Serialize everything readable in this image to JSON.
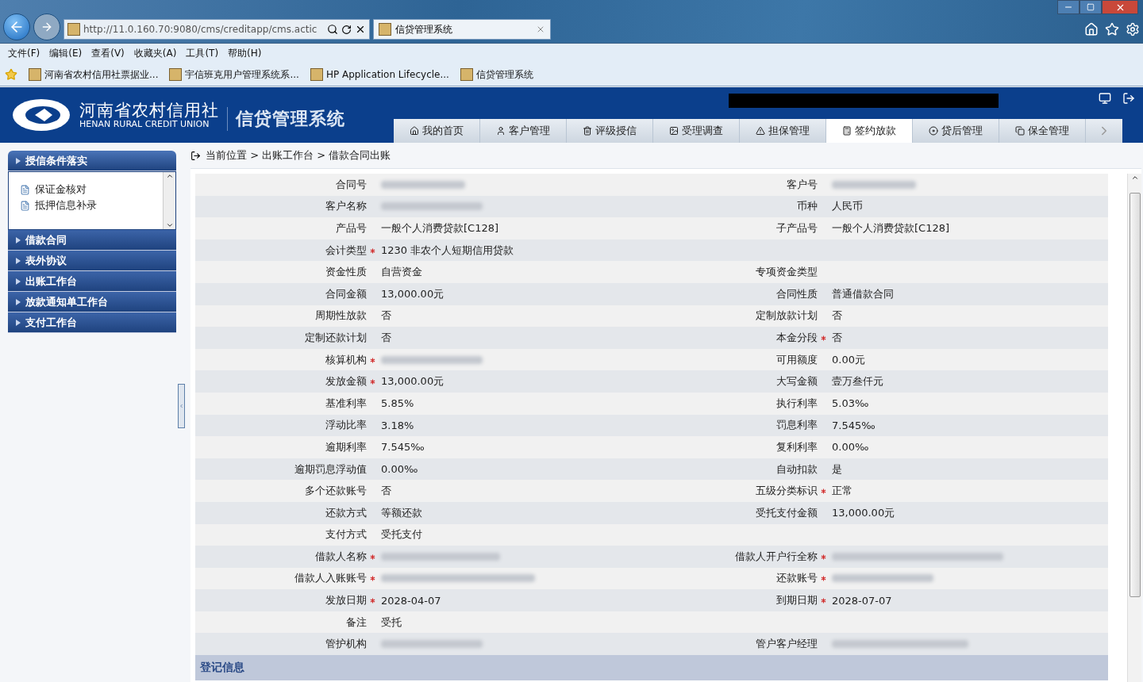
{
  "browser": {
    "address": "http://11.0.160.70:9080/cms/creditapp/cms.actic",
    "tabs": [
      {
        "title": "信贷管理系统",
        "selected": true
      }
    ],
    "menu": [
      "文件(F)",
      "编辑(E)",
      "查看(V)",
      "收藏夹(A)",
      "工具(T)",
      "帮助(H)"
    ],
    "favorites": [
      "河南省农村信用社票据业...",
      "宇信班克用户管理系统系...",
      "HP Application Lifecycle...",
      "信贷管理系统"
    ]
  },
  "header": {
    "org_name": "河南省农村信用社",
    "org_name_en": "HENAN RURAL CREDIT UNION",
    "system_name": "信贷管理系统",
    "redacted": true
  },
  "nav": [
    {
      "label": "我的首页",
      "selected": false
    },
    {
      "label": "客户管理",
      "selected": false
    },
    {
      "label": "评级授信",
      "selected": false
    },
    {
      "label": "受理调查",
      "selected": false
    },
    {
      "label": "担保管理",
      "selected": false
    },
    {
      "label": "签约放款",
      "selected": true
    },
    {
      "label": "贷后管理",
      "selected": false
    },
    {
      "label": "保全管理",
      "selected": false
    }
  ],
  "sidebar": [
    {
      "label": "授信条件落实",
      "expanded": true,
      "children": [
        "保证金核对",
        "抵押信息补录"
      ]
    },
    {
      "label": "借款合同",
      "expanded": false
    },
    {
      "label": "表外协议",
      "expanded": false
    },
    {
      "label": "出账工作台",
      "expanded": false
    },
    {
      "label": "放款通知单工作台",
      "expanded": false
    },
    {
      "label": "支付工作台",
      "expanded": false
    }
  ],
  "breadcrumb": "当前位置 > 出账工作台 > 借款合同出账",
  "form_rows": [
    [
      {
        "label": "合同号",
        "required": false,
        "redacted": true
      },
      {
        "label": "客户号",
        "required": false,
        "redacted": true
      }
    ],
    [
      {
        "label": "客户名称",
        "required": false,
        "redacted": true
      },
      {
        "label": "币种",
        "required": false,
        "value": "人民币"
      }
    ],
    [
      {
        "label": "产品号",
        "required": false,
        "value": "一般个人消费贷款[C128]"
      },
      {
        "label": "子产品号",
        "required": false,
        "value": "一般个人消费贷款[C128]"
      }
    ],
    [
      {
        "label": "会计类型",
        "required": true,
        "value": "1230 非农个人短期信用贷款"
      }
    ],
    [
      {
        "label": "资金性质",
        "required": false,
        "value": "自营资金"
      },
      {
        "label": "专项资金类型",
        "required": false
      }
    ],
    [
      {
        "label": "合同金额",
        "required": false,
        "value": "13,000.00元"
      },
      {
        "label": "合同性质",
        "required": false,
        "value": "普通借款合同"
      }
    ],
    [
      {
        "label": "周期性放款",
        "required": false,
        "value": "否"
      },
      {
        "label": "定制放款计划",
        "required": false,
        "value": "否"
      }
    ],
    [
      {
        "label": "定制还款计划",
        "required": false,
        "value": "否"
      },
      {
        "label": "本金分段",
        "required": true,
        "value": "否"
      }
    ],
    [
      {
        "label": "核算机构",
        "required": true,
        "redacted": true
      },
      {
        "label": "可用额度",
        "required": false,
        "value": "0.00元"
      }
    ],
    [
      {
        "label": "发放金额",
        "required": true,
        "value": "13,000.00元"
      },
      {
        "label": "大写金额",
        "required": false,
        "value": "壹万叁仟元"
      }
    ],
    [
      {
        "label": "基准利率",
        "required": false,
        "value": "5.85%"
      },
      {
        "label": "执行利率",
        "required": false,
        "value": "5.03‰"
      }
    ],
    [
      {
        "label": "浮动比率",
        "required": false,
        "value": "3.18%"
      },
      {
        "label": "罚息利率",
        "required": false,
        "value": "7.545‰"
      }
    ],
    [
      {
        "label": "逾期利率",
        "required": false,
        "value": "7.545‰"
      },
      {
        "label": "复利利率",
        "required": false,
        "value": "0.00‰"
      }
    ],
    [
      {
        "label": "逾期罚息浮动值",
        "required": false,
        "value": "0.00‰"
      },
      {
        "label": "自动扣款",
        "required": false,
        "value": "是"
      }
    ],
    [
      {
        "label": "多个还款账号",
        "required": false,
        "value": "否"
      },
      {
        "label": "五级分类标识",
        "required": true,
        "value": "正常"
      }
    ],
    [
      {
        "label": "还款方式",
        "required": false,
        "value": "等额还款"
      },
      {
        "label": "受托支付金额",
        "required": false,
        "value": "13,000.00元"
      }
    ],
    [
      {
        "label": "支付方式",
        "required": false,
        "value": "受托支付"
      }
    ],
    [
      {
        "label": "借款人名称",
        "required": true,
        "redacted": true
      },
      {
        "label": "借款人开户行全称",
        "required": true,
        "redacted": true
      }
    ],
    [
      {
        "label": "借款人入账账号",
        "required": true,
        "redacted": true
      },
      {
        "label": "还款账号",
        "required": true,
        "redacted": true
      }
    ],
    [
      {
        "label": "发放日期",
        "required": true,
        "value": "2028-04-07"
      },
      {
        "label": "到期日期",
        "required": true,
        "value": "2028-07-07"
      }
    ],
    [
      {
        "label": "备注",
        "required": false,
        "value": "受托"
      }
    ],
    [
      {
        "label": "管护机构",
        "required": false,
        "redacted": true
      },
      {
        "label": "管户客户经理",
        "required": false,
        "redacted": true
      }
    ]
  ],
  "section_title": "登记信息"
}
